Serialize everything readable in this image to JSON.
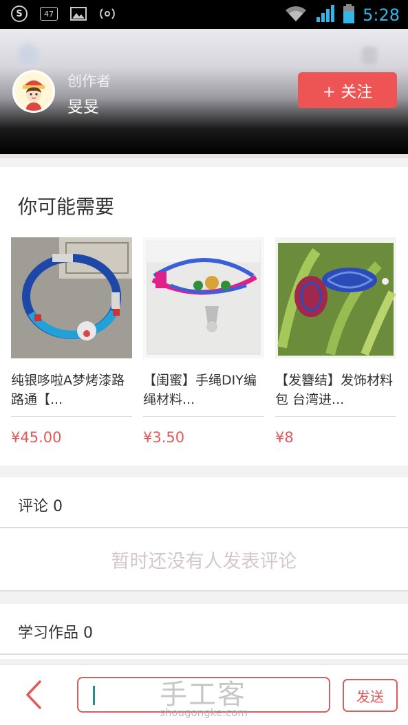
{
  "status_bar": {
    "left_icons": [
      "s-icon",
      "battery-47-icon",
      "image-icon",
      "wireless-icon"
    ],
    "badge_number": "47",
    "s_letter": "S",
    "time": "5:28",
    "accent": "#33b5e5"
  },
  "header": {
    "creator_label": "创作者",
    "creator_name": "旻旻",
    "follow_label": "+ 关注",
    "follow_color": "#ef5454"
  },
  "recommend": {
    "title": "你可能需要",
    "products": [
      {
        "name": "纯银哆啦A梦烤漆路路通【...",
        "price": "¥45.00"
      },
      {
        "name": "【闺蜜】手绳DIY编绳材料...",
        "price": "¥3.50"
      },
      {
        "name": "【发簪结】发饰材料包 台湾进...",
        "price": "¥8"
      }
    ]
  },
  "comments": {
    "title": "评论 0",
    "empty_text": "暂时还没有人发表评论"
  },
  "works": {
    "title": "学习作品 0"
  },
  "bottom_bar": {
    "send_label": "发送",
    "input_value": "",
    "watermark_main": "手工客",
    "watermark_sub": "shougongke.com",
    "accent": "#e05a5a"
  }
}
